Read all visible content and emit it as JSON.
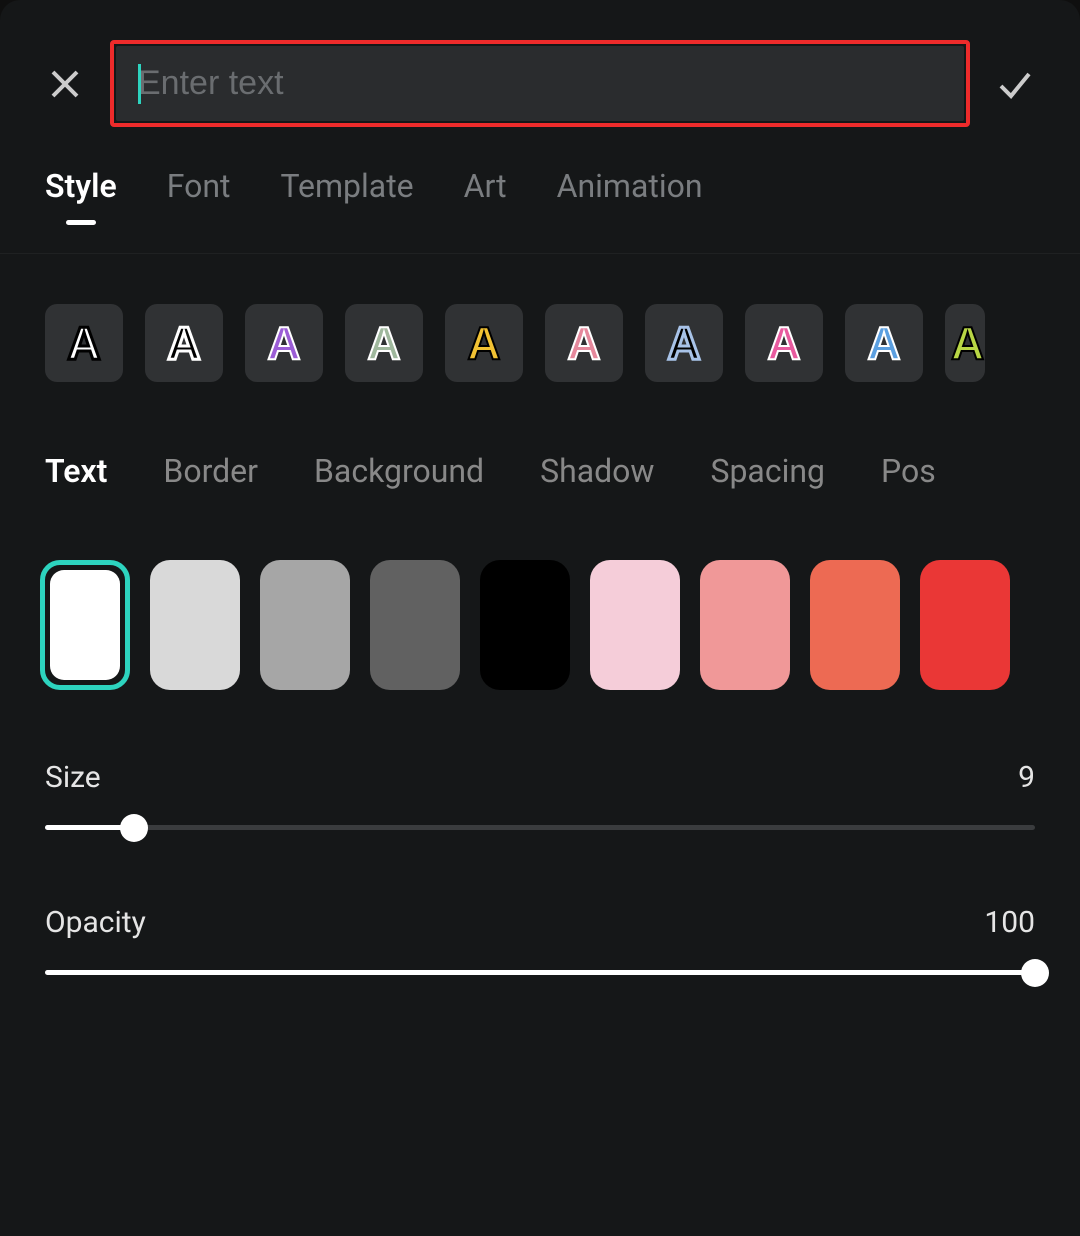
{
  "header": {
    "placeholder": "Enter text",
    "value": ""
  },
  "tabs": [
    {
      "label": "Style",
      "active": true
    },
    {
      "label": "Font",
      "active": false
    },
    {
      "label": "Template",
      "active": false
    },
    {
      "label": "Art",
      "active": false
    },
    {
      "label": "Animation",
      "active": false
    }
  ],
  "presets": [
    {
      "name": "white-black-outline",
      "fill": "#ffffff",
      "stroke": "#000000"
    },
    {
      "name": "black-white-outline",
      "fill": "#000000",
      "stroke": "#ffffff"
    },
    {
      "name": "purple-white-outline",
      "fill": "#9b5dd6",
      "stroke": "#ffffff"
    },
    {
      "name": "sage-white-outline",
      "fill": "#9fb89d",
      "stroke": "#ffffff"
    },
    {
      "name": "yellow-black-outline",
      "fill": "#f2c233",
      "stroke": "#000000"
    },
    {
      "name": "pink-white-outline",
      "fill": "#e5889c",
      "stroke": "#ffffff"
    },
    {
      "name": "black-blue-outline",
      "fill": "#000000",
      "stroke": "#a8c3e8"
    },
    {
      "name": "pink-bold-white-outline",
      "fill": "#e85a9f",
      "stroke": "#ffffff"
    },
    {
      "name": "blue-white-outline",
      "fill": "#5b9fe0",
      "stroke": "#ffffff"
    },
    {
      "name": "lime-partial",
      "fill": "#b8d645",
      "stroke": "#000000"
    }
  ],
  "sub_tabs": [
    {
      "label": "Text",
      "active": true
    },
    {
      "label": "Border",
      "active": false
    },
    {
      "label": "Background",
      "active": false
    },
    {
      "label": "Shadow",
      "active": false
    },
    {
      "label": "Spacing",
      "active": false
    },
    {
      "label": "Pos",
      "active": false
    }
  ],
  "colors": [
    {
      "hex": "#ffffff",
      "selected": true
    },
    {
      "hex": "#d9d9d9",
      "selected": false
    },
    {
      "hex": "#a6a6a6",
      "selected": false
    },
    {
      "hex": "#616161",
      "selected": false
    },
    {
      "hex": "#000000",
      "selected": false
    },
    {
      "hex": "#f5cdd9",
      "selected": false
    },
    {
      "hex": "#f09898",
      "selected": false
    },
    {
      "hex": "#ed6a53",
      "selected": false
    },
    {
      "hex": "#ea3736",
      "selected": false
    }
  ],
  "sliders": {
    "size": {
      "label": "Size",
      "value": "9",
      "percent": 9
    },
    "opacity": {
      "label": "Opacity",
      "value": "100",
      "percent": 100
    }
  }
}
